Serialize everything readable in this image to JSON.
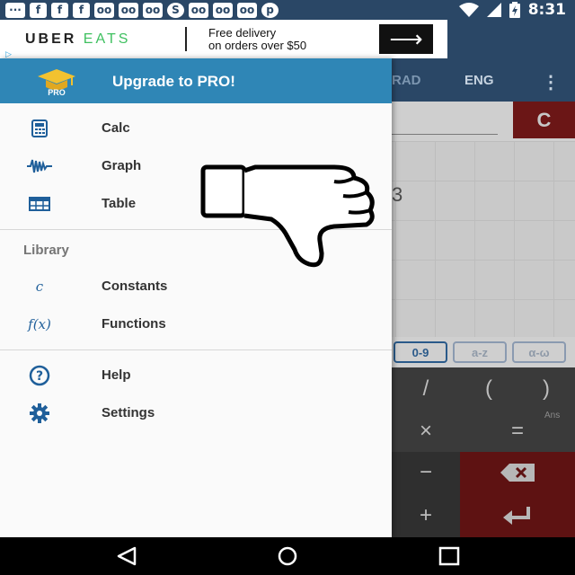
{
  "status_bar": {
    "notification_icons": [
      "messenger-icon",
      "facebook-icon",
      "facebook-icon",
      "facebook-icon",
      "voicemail-icon",
      "voicemail-icon",
      "voicemail-icon",
      "skype-icon",
      "voicemail-icon",
      "voicemail-icon",
      "voicemail-icon",
      "pinterest-icon"
    ],
    "time": "8:31",
    "right_icons": [
      "wifi-icon",
      "signal-icon",
      "battery-charging-icon"
    ]
  },
  "ad": {
    "brand_uber": "UBER",
    "brand_eats": "EATS",
    "line1": "Free delivery",
    "line2": "on orders over $50",
    "cta_icon": "arrow-right-icon"
  },
  "toolbar": {
    "rad_label": "RAD",
    "eng_label": "ENG",
    "more_icon": "more-vert-icon"
  },
  "calculator": {
    "clear_label": "C",
    "result_fragment": "3",
    "modes": [
      "0-9",
      "a-z",
      "α-ω"
    ],
    "active_mode": "0-9",
    "keys": {
      "divide": "/",
      "lparen": "(",
      "rparen": ")",
      "times": "×",
      "equals": "=",
      "minus": "−",
      "plus": "+",
      "ans_label": "Ans"
    }
  },
  "drawer": {
    "header": {
      "badge_text": "PRO",
      "upgrade_label": "Upgrade to PRO!"
    },
    "main_items": [
      {
        "label": "Calc",
        "icon": "calculator-icon"
      },
      {
        "label": "Graph",
        "icon": "graph-wave-icon"
      },
      {
        "label": "Table",
        "icon": "table-icon"
      }
    ],
    "library_label": "Library",
    "library_items": [
      {
        "label": "Constants",
        "icon_text": "c",
        "icon": "constants-icon"
      },
      {
        "label": "Functions",
        "icon_text": "f(x)",
        "icon": "functions-icon"
      }
    ],
    "footer_items": [
      {
        "label": "Help",
        "icon": "help-icon"
      },
      {
        "label": "Settings",
        "icon": "settings-gear-icon"
      }
    ]
  },
  "overlay": {
    "icon": "thumbs-down-icon"
  },
  "nav_bar": {
    "icons": [
      "back-icon",
      "home-icon",
      "recents-icon"
    ]
  },
  "colors": {
    "status_bar": "#2a4766",
    "drawer_header": "#2f86b6",
    "accent_icon": "#1f5f9a",
    "clear_button": "#6b1616"
  }
}
